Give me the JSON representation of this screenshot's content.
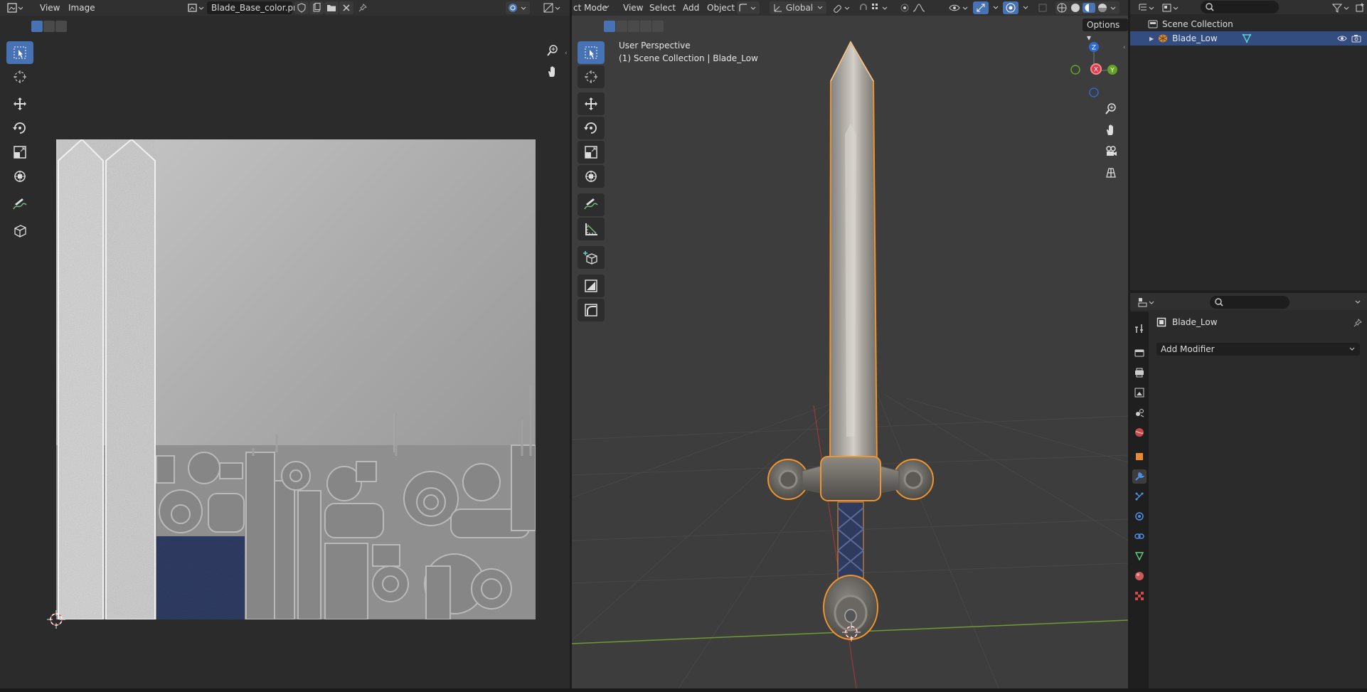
{
  "image_editor": {
    "menus": [
      "View",
      "Image"
    ],
    "image_name": "Blade_Base_color.png"
  },
  "viewport": {
    "mode_label": "ct Mode",
    "menus": [
      "View",
      "Select",
      "Add",
      "Object"
    ],
    "orientation": "Global",
    "options_label": "Options",
    "overlay_line1": "User Perspective",
    "overlay_line2": "(1) Scene Collection | Blade_Low",
    "gizmo": {
      "z": "Z",
      "y": "Y",
      "x": "X"
    }
  },
  "outliner": {
    "scene_collection": "Scene Collection",
    "items": [
      {
        "label": "Blade_Low",
        "selected": true
      }
    ]
  },
  "properties": {
    "object_name": "Blade_Low",
    "add_modifier": "Add Modifier",
    "active_tab": "modifiers"
  },
  "colors": {
    "accent": "#4772b3",
    "selection_outline": "#f0942d",
    "selected_row": "#334d80"
  }
}
